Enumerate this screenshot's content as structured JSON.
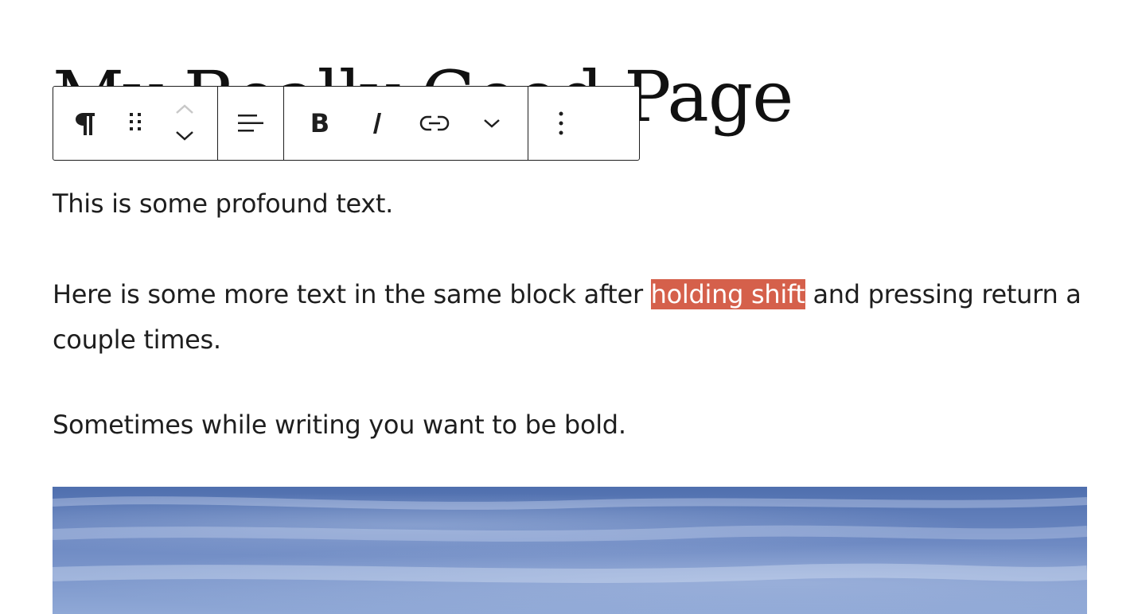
{
  "page": {
    "title": "My Really Good Page"
  },
  "toolbar": {
    "paragraph_icon": "pilcrow-icon",
    "drag_icon": "drag-handle-icon",
    "move_up_icon": "chevron-up-icon",
    "move_down_icon": "chevron-down-icon",
    "align_icon": "align-left-icon",
    "bold_label": "B",
    "italic_icon": "italic-icon",
    "link_icon": "link-icon",
    "more_formats_icon": "chevron-down-icon",
    "options_icon": "more-vertical-icon"
  },
  "content": {
    "paragraph1": "This is some profound text.",
    "paragraph2_before": "Here is some more text in the same block after ",
    "paragraph2_selected": "holding shift",
    "paragraph2_after": " and pressing return a couple times.",
    "paragraph3": "Sometimes while writing you want to be bold."
  },
  "colors": {
    "selection_highlight": "#d5604b",
    "text": "#1e1e1e",
    "sky_image": "#6b87c1"
  }
}
